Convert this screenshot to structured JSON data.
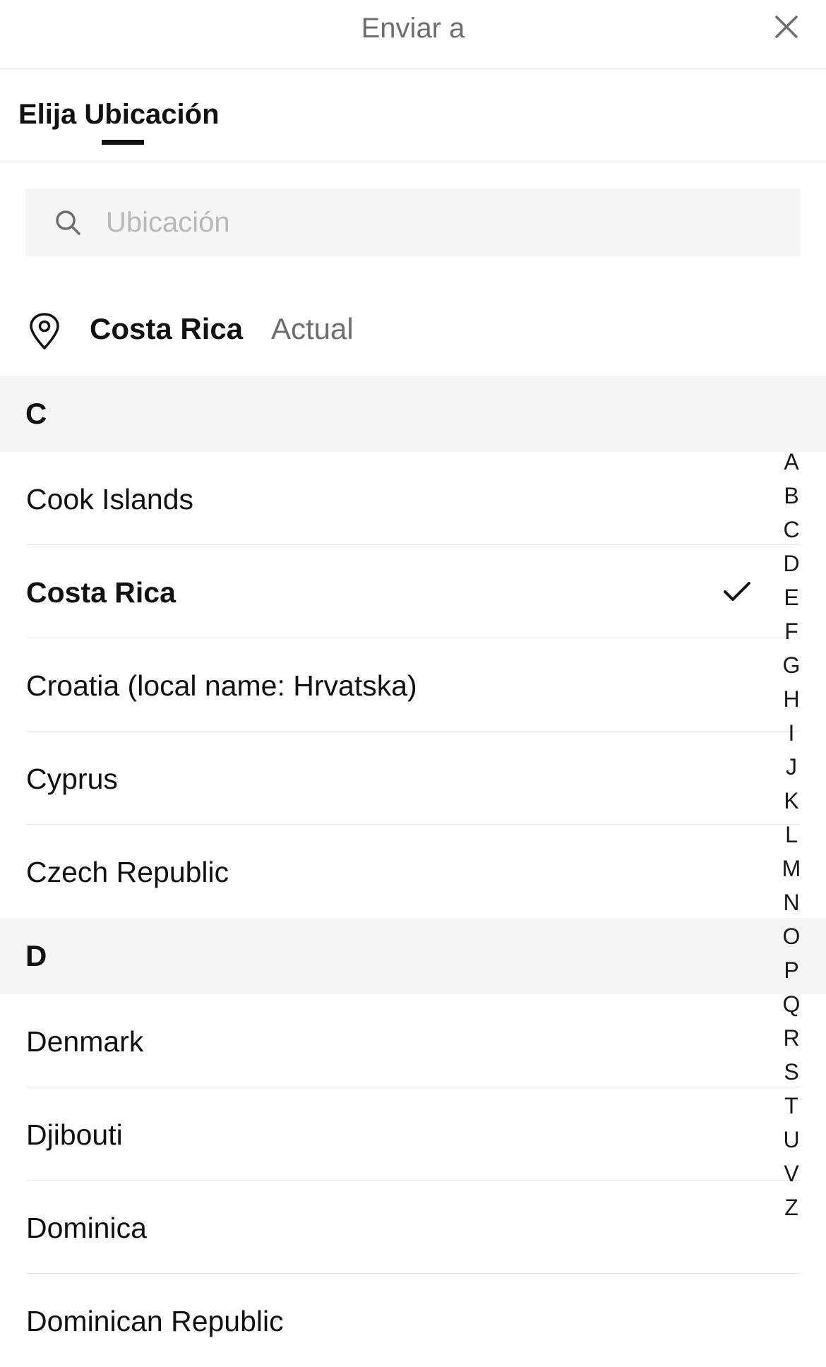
{
  "header": {
    "title": "Enviar a"
  },
  "tabs": [
    {
      "label": "Elija Ubicación",
      "active": true
    }
  ],
  "search": {
    "placeholder": "Ubicación",
    "value": ""
  },
  "current_location": {
    "country": "Costa Rica",
    "tag": "Actual"
  },
  "sections": [
    {
      "letter": "C",
      "items": [
        {
          "label": "Cook Islands",
          "selected": false
        },
        {
          "label": "Costa Rica",
          "selected": true
        },
        {
          "label": "Croatia (local name: Hrvatska)",
          "selected": false
        },
        {
          "label": "Cyprus",
          "selected": false
        },
        {
          "label": "Czech Republic",
          "selected": false
        }
      ]
    },
    {
      "letter": "D",
      "items": [
        {
          "label": "Denmark",
          "selected": false
        },
        {
          "label": "Djibouti",
          "selected": false
        },
        {
          "label": "Dominica",
          "selected": false
        },
        {
          "label": "Dominican Republic",
          "selected": false
        }
      ]
    }
  ],
  "alphabet_index": [
    "A",
    "B",
    "C",
    "D",
    "E",
    "F",
    "G",
    "H",
    "I",
    "J",
    "K",
    "L",
    "M",
    "N",
    "O",
    "P",
    "Q",
    "R",
    "S",
    "T",
    "U",
    "V",
    "Z"
  ],
  "icons": {
    "close": "close-icon",
    "search": "search-icon",
    "pin": "location-pin-icon",
    "check": "checkmark-icon"
  },
  "colors": {
    "text_primary": "#111111",
    "text_secondary": "#6e6e6e",
    "placeholder": "#b8b8b8",
    "section_bg": "#f5f5f5",
    "divider": "#e6e6e6"
  }
}
